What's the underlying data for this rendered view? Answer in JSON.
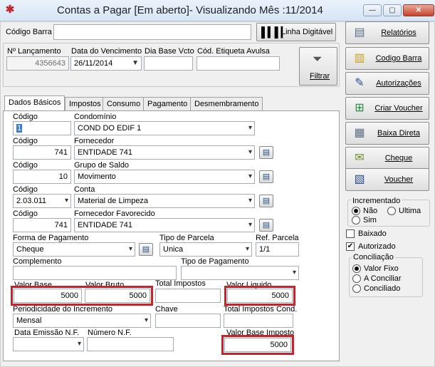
{
  "window": {
    "title": "Contas a Pagar [Em aberto]- Visualizando Mês :11/2014",
    "minimize": "—",
    "maximize": "▢",
    "close": "✕"
  },
  "barcode": {
    "label": "Código Barra",
    "value": "",
    "button": "Linha Digitável"
  },
  "filter": {
    "lancamento_label": "Nº Lançamento",
    "lancamento_value": "4356643",
    "vencimento_label": "Data do Vencimento",
    "vencimento_value": "26/11/2014",
    "dia_base_label": "Dia Base Vcto",
    "dia_base_value": "",
    "etiqueta_label": "Cód. Etiqueta Avulsa",
    "etiqueta_value": "",
    "filtrar_label": "Filtrar"
  },
  "tabs": [
    "Dados Básicos",
    "Impostos",
    "Consumo",
    "Pagamento",
    "Desmembramento"
  ],
  "form": {
    "codigo_label": "Código",
    "condominio_label": "Condomínio",
    "condominio_code": "1",
    "condominio_value": "COND DO EDIF 1",
    "fornecedor_label": "Fornecedor",
    "fornecedor_code": "741",
    "fornecedor_value": "ENTIDADE 741",
    "grupo_label": "Grupo de Saldo",
    "grupo_code": "10",
    "grupo_value": "Movimento",
    "conta_label": "Conta",
    "conta_code": "2.03.011",
    "conta_value": "Material de Limpeza",
    "favorecido_label": "Fornecedor Favorecido",
    "favorecido_code": "741",
    "favorecido_value": "ENTIDADE 741",
    "forma_label": "Forma de Pagamento",
    "forma_value": "Cheque",
    "tipo_parcela_label": "Tipo de Parcela",
    "tipo_parcela_value": "Unica",
    "ref_parcela_label": "Ref. Parcela",
    "ref_parcela_value": "1/1",
    "complemento_label": "Complemento",
    "complemento_value": "",
    "tipo_pagamento_label": "Tipo de Pagamento",
    "tipo_pagamento_value": "",
    "valor_base_label": "Valor Base",
    "valor_base_value": "5000",
    "valor_bruto_label": "Valor Bruto",
    "valor_bruto_value": "5000",
    "total_impostos_label": "Total Impostos",
    "total_impostos_value": "",
    "valor_liquido_label": "Valor Liquido",
    "valor_liquido_value": "5000",
    "periodicidade_label": "Periodicidade do Incremento",
    "periodicidade_value": "Mensal",
    "chave_label": "Chave",
    "chave_value": "",
    "total_impostos_cond_label": "Total Impostos Cond.",
    "total_impostos_cond_value": "",
    "data_emissao_label": "Data Emissão N.F.",
    "data_emissao_value": "",
    "numero_nf_label": "Número N.F.",
    "numero_nf_value": "",
    "valor_base_imposto_label": "Valor Base Imposto",
    "valor_base_imposto_value": "5000"
  },
  "actions": [
    "Relatórios",
    "Codigo Barra",
    "Autorizações",
    "Criar Voucher",
    "Baixa Direta",
    "Cheque",
    "Voucher"
  ],
  "incremento": {
    "title": "Incrementado",
    "nao": "Não",
    "ultima": "Ultima",
    "sim": "Sim"
  },
  "flags": {
    "baixado": "Baixado",
    "autorizado": "Autorizado"
  },
  "conciliacao": {
    "title": "Conciliação",
    "valor_fixo": "Valor Fixo",
    "a_conciliar": "A Conciliar",
    "conciliado": "Conciliado"
  },
  "colors": {
    "highlight": "#c8222d",
    "titlebar": "#dae8f6"
  }
}
